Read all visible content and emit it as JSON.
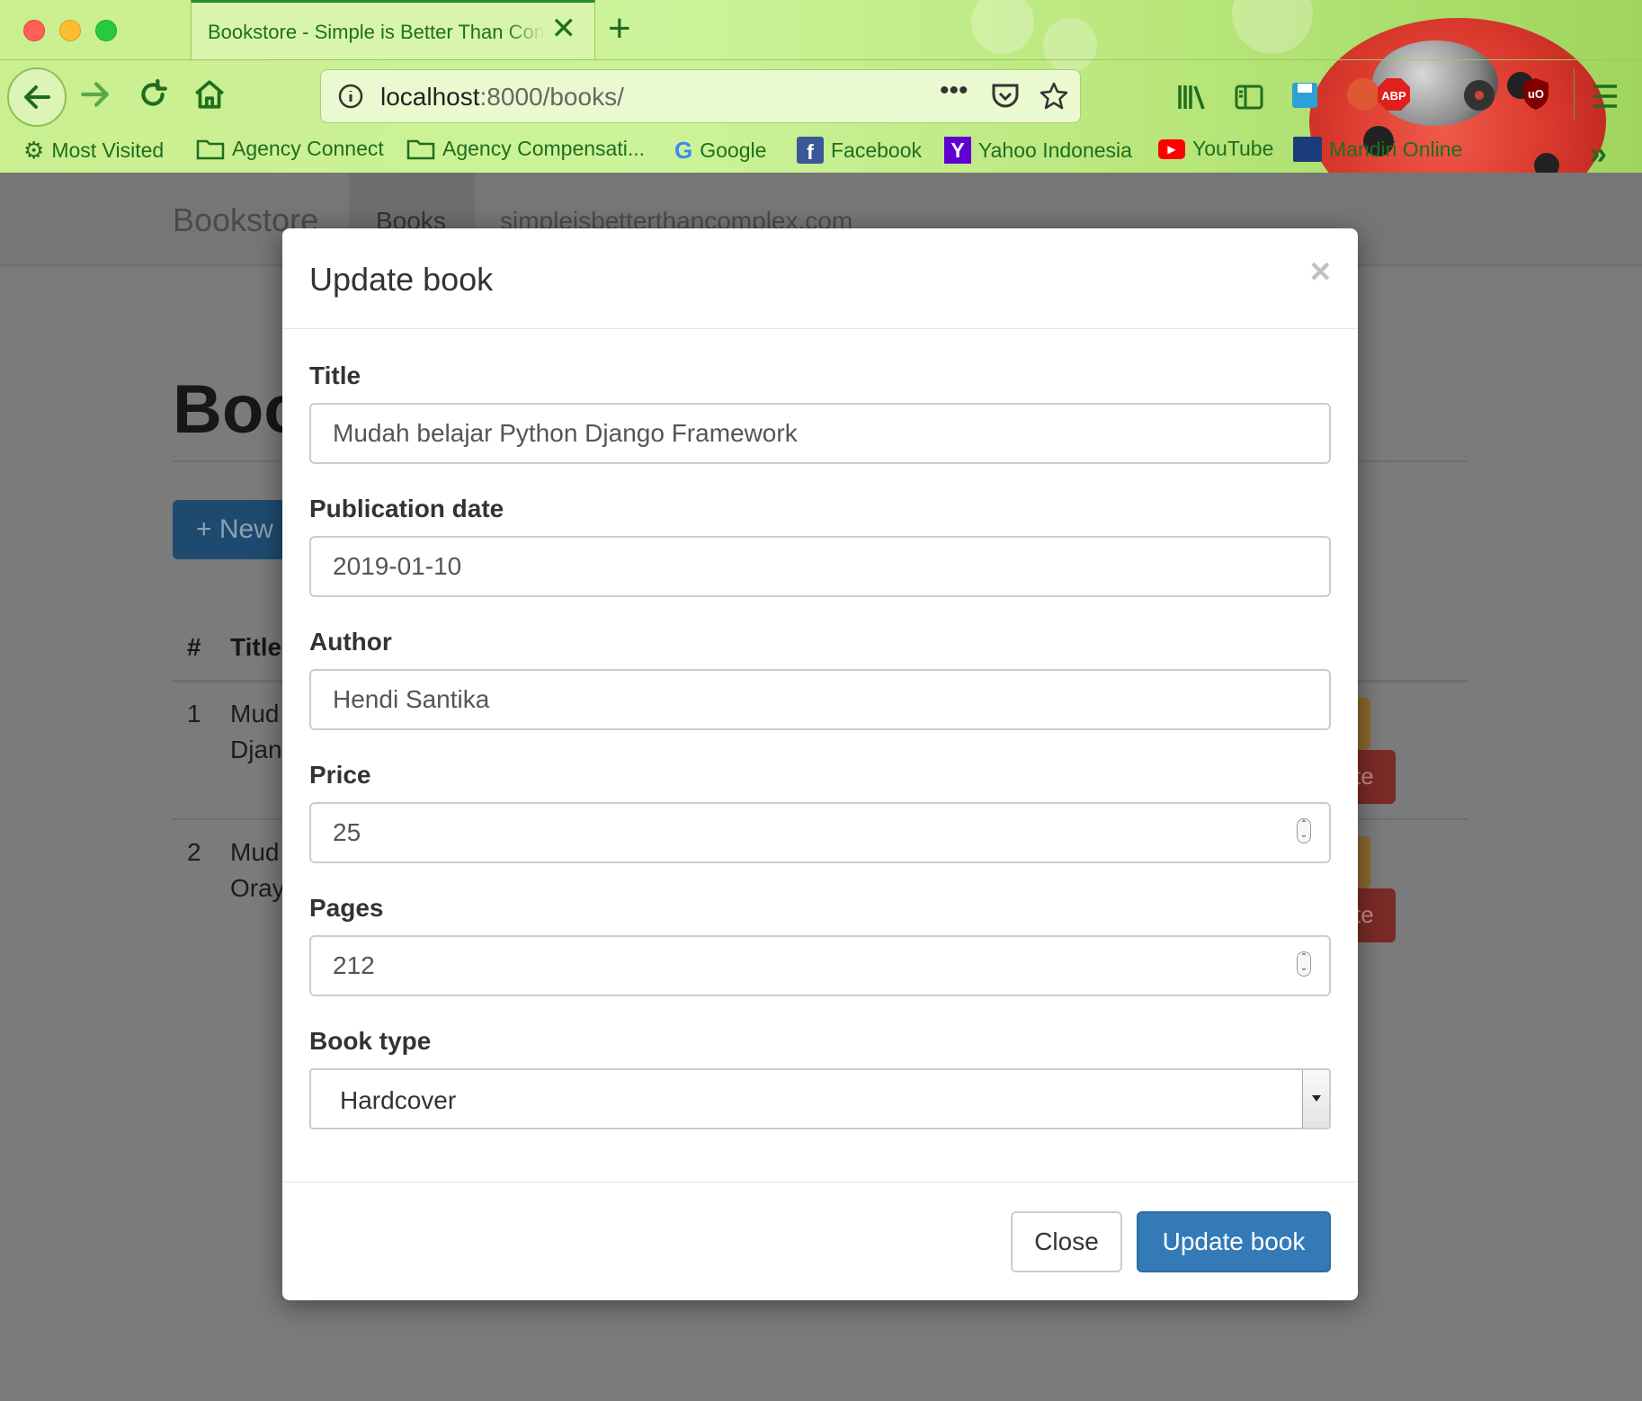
{
  "browser": {
    "tab_title": "Bookstore - Simple is Better Than Complex",
    "url_host": "localhost",
    "url_rest": ":8000/books/",
    "bookmarks": [
      "Most Visited",
      "Agency Connect",
      "Agency Compensati...",
      "Google",
      "Facebook",
      "Yahoo Indonesia",
      "YouTube",
      "Mandiri Online"
    ]
  },
  "page": {
    "brand": "Bookstore",
    "nav_books": "Books",
    "nav_site": "simpleisbetterthancomplex.com",
    "heading": "Boo",
    "new_button": "+ New",
    "table_headers": [
      "#",
      "Title"
    ],
    "rows": [
      {
        "num": "1",
        "line1": "Mud",
        "line2": "Djan",
        "btn": "te"
      },
      {
        "num": "2",
        "line1": "Mud",
        "line2": "Oray",
        "btn": "te"
      }
    ]
  },
  "modal": {
    "title": "Update book",
    "close_glyph": "×",
    "fields": {
      "title": {
        "label": "Title",
        "value": "Mudah belajar Python Django Framework"
      },
      "publication_date": {
        "label": "Publication date",
        "value": "2019-01-10"
      },
      "author": {
        "label": "Author",
        "value": "Hendi Santika"
      },
      "price": {
        "label": "Price",
        "value": "25"
      },
      "pages": {
        "label": "Pages",
        "value": "212"
      },
      "book_type": {
        "label": "Book type",
        "value": "Hardcover"
      }
    },
    "close_button": "Close",
    "update_button": "Update book"
  },
  "colors": {
    "primary": "#337ab7",
    "chrome_green": "#1f6e1f"
  }
}
